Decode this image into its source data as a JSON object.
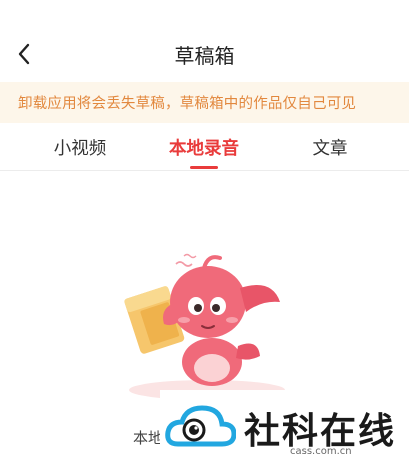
{
  "header": {
    "back_icon": "chevron-left-icon",
    "title": "草稿箱"
  },
  "notice": {
    "text": "卸载应用将会丢失草稿，草稿箱中的作品仅自己可见",
    "color": "#e2883e",
    "background": "#fdf6ea"
  },
  "tabs": [
    {
      "label": "小视频",
      "active": false
    },
    {
      "label": "本地录音",
      "active": true
    },
    {
      "label": "文章",
      "active": false
    }
  ],
  "accent_color": "#e93b3b",
  "empty_state": {
    "illustration": "pink-mascot-holding-box",
    "message": "本地"
  },
  "watermark": {
    "logo": "cloud-eye-logo",
    "name": "社科在线",
    "url": "cass.com.cn"
  }
}
